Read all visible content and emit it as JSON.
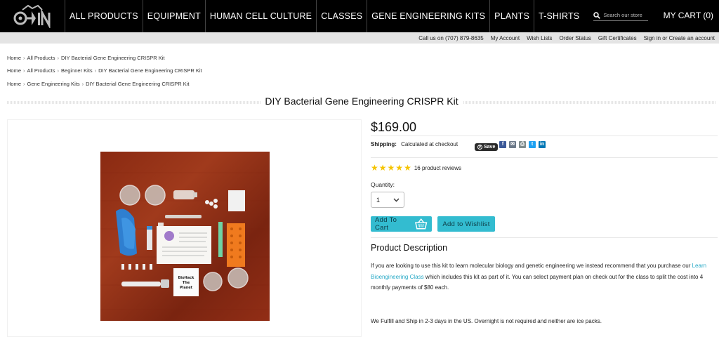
{
  "nav": {
    "items": [
      "ALL PRODUCTS",
      "EQUIPMENT",
      "HUMAN CELL CULTURE",
      "CLASSES",
      "GENE ENGINEERING KITS",
      "PLANTS",
      "T-SHIRTS"
    ],
    "search_placeholder": "Search our store",
    "cart": "MY CART (0)"
  },
  "utility": {
    "items": [
      "Call us on (707) 879-8635",
      "My Account",
      "Wish Lists",
      "Order Status",
      "Gift Certificates",
      "Sign in or Create an account"
    ]
  },
  "breadcrumbs": [
    [
      "Home",
      "All Products",
      "DIY Bacterial Gene Engineering CRISPR Kit"
    ],
    [
      "Home",
      "All Products",
      "Beginner Kits",
      "DIY Bacterial Gene Engineering CRISPR Kit"
    ],
    [
      "Home",
      "Gene Engineering Kits",
      "DIY Bacterial Gene Engineering CRISPR Kit"
    ]
  ],
  "product": {
    "title": "DIY Bacterial Gene Engineering CRISPR Kit",
    "price": "$169.00",
    "shipping_label": "Shipping:",
    "shipping_value": "Calculated at checkout",
    "pin_save": "Save",
    "rating": 5,
    "reviews": "16 product reviews",
    "quantity_label": "Quantity:",
    "quantity_value": "1",
    "add_to_cart": "Add To Cart",
    "add_to_wishlist": "Add to Wishlist",
    "description_title": "Product Description",
    "description_1a": "If you are looking to use this kit to learn molecular biology and genetic engineering we instead recommend that you purchase our ",
    "description_link": "Learn Bioengineering Class",
    "description_1b": " which includes this kit as part of it. You can select payment plan on check out for the class to split the cost into 4 monthly payments of $80 each.",
    "description_2": "We Fulfill and Ship in 2-3 days in the US. Overnight is not required and neither are ice packs.",
    "image_card_text": [
      "BioHack",
      "The",
      "Planet"
    ]
  },
  "share_icons": [
    {
      "name": "facebook-icon",
      "color": "#3b5998",
      "glyph": "f"
    },
    {
      "name": "email-icon",
      "color": "#6c7a89",
      "glyph": "✉"
    },
    {
      "name": "print-icon",
      "color": "#7f8c8d",
      "glyph": "⎙"
    },
    {
      "name": "twitter-icon",
      "color": "#1da1f2",
      "glyph": "t"
    },
    {
      "name": "linkedin-icon",
      "color": "#0077b5",
      "glyph": "in"
    }
  ],
  "colors": {
    "accent": "#33bcd0",
    "link": "#27a9c6",
    "star": "#f5c400"
  }
}
